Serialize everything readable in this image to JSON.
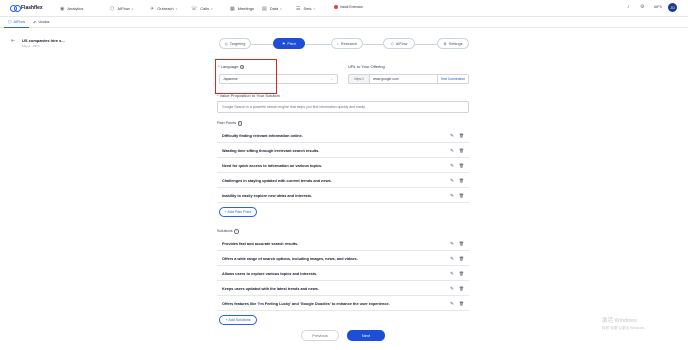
{
  "app": {
    "name": "Flashflex"
  },
  "nav": [
    {
      "icon": "analytics-icon",
      "glyph": "◉",
      "label": "Analytics"
    },
    {
      "icon": "aiflow-icon",
      "glyph": "⬡",
      "label": "AIFlow"
    },
    {
      "icon": "outreach-icon",
      "glyph": "✈",
      "label": "Outreach"
    },
    {
      "icon": "calls-icon",
      "glyph": "☏",
      "label": "Calls"
    },
    {
      "icon": "meetings-icon",
      "glyph": "▦",
      "label": "Meetings"
    },
    {
      "icon": "data-icon",
      "glyph": "▤",
      "label": "Data"
    },
    {
      "icon": "sets-icon",
      "glyph": "☰",
      "label": "Sets"
    }
  ],
  "extension": {
    "label": "Install Extension"
  },
  "credits": "AIFS",
  "avatar": "JO",
  "tabs": [
    {
      "label": "AIFlow",
      "active": true
    },
    {
      "label": "Undos",
      "active": false
    }
  ],
  "campaign": {
    "title": "US companies hire s...",
    "subtitle": "May 2 · Pitch"
  },
  "steps": [
    {
      "label": "Targeting",
      "glyph": "◎"
    },
    {
      "label": "Pitch",
      "glyph": "⚑",
      "active": true
    },
    {
      "label": "Research",
      "glyph": "⌕"
    },
    {
      "label": "AIFlow",
      "glyph": "⬡"
    },
    {
      "label": "Settings",
      "glyph": "⚙"
    }
  ],
  "language": {
    "label": "Language",
    "value": "Japanese"
  },
  "url": {
    "label": "URL to Your Offering",
    "prefix": "https://",
    "value": "www.google.com",
    "button": "Test Connection"
  },
  "value_prop": {
    "label": "Value Proposition to Your Solution",
    "value": "Google Search is a powerful search engine that helps you find information quickly and easily."
  },
  "pain_points": {
    "label": "Pain Points",
    "items": [
      "Difficulty finding relevant information online.",
      "Wasting time sifting through irrelevant search results.",
      "Need for quick access to information on various topics.",
      "Challenges in staying updated with current trends and news.",
      "Inability to easily explore new ideas and interests."
    ],
    "add_label": "+ Add Pain Point"
  },
  "solutions": {
    "label": "Solutions",
    "items": [
      "Provides fast and accurate search results.",
      "Offers a wide range of search options, including images, news, and videos.",
      "Allows users to explore various topics and interests.",
      "Keeps users updated with the latest trends and news.",
      "Offers features like 'I'm Feeling Lucky' and 'Google Doodles' to enhance the user experience."
    ],
    "add_label": "+ Add Solutions"
  },
  "footer": {
    "previous": "Previous",
    "next": "Next"
  },
  "watermark": {
    "line1": "激活 Windows",
    "line2": "转到\"设置\"以激活 Windows。"
  }
}
